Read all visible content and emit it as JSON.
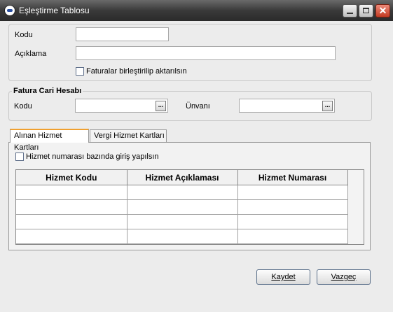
{
  "window": {
    "title": "Eşleştirme Tablosu",
    "close_glyph": "✕"
  },
  "general": {
    "kodu_label": "Kodu",
    "aciklama_label": "Açıklama",
    "kodu_value": "",
    "aciklama_value": "",
    "merge_invoices_label": "Faturalar birleştirilip aktarılsın",
    "merge_invoices_checked": false
  },
  "fatura_cari": {
    "title": "Fatura Cari Hesabı",
    "kodu_label": "Kodu",
    "unvani_label": "Ünvanı",
    "kodu_value": "",
    "unvani_value": "",
    "lookup_glyph": "..."
  },
  "tabs": [
    {
      "label": "Alınan Hizmet Kartları",
      "active": true
    },
    {
      "label": "Vergi Hizmet Kartları",
      "active": false
    }
  ],
  "tab_content": {
    "service_number_label": "Hizmet numarası bazında giriş yapılsın",
    "service_number_checked": false,
    "columns": [
      "Hizmet Kodu",
      "Hizmet Açıklaması",
      "Hizmet Numarası"
    ],
    "rows": [
      [
        "",
        "",
        ""
      ],
      [
        "",
        "",
        ""
      ],
      [
        "",
        "",
        ""
      ],
      [
        "",
        "",
        ""
      ]
    ]
  },
  "buttons": {
    "save": "Kaydet",
    "cancel": "Vazgeç"
  },
  "icons": {
    "app": "app-logo-icon",
    "minimize": "minimize-icon",
    "maximize": "maximize-icon",
    "close": "close-icon",
    "lookup": "ellipsis-icon"
  },
  "colors": {
    "titlebar": "#3a3a3a",
    "close_button": "#c23b22",
    "active_tab_accent": "#f0a030",
    "background": "#ececec"
  }
}
